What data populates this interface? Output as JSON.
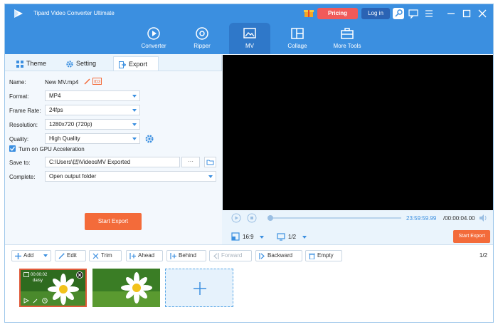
{
  "app": {
    "title": "Tipard Video Converter Ultimate",
    "pricing_label": "Pricing",
    "login_label": "Log in"
  },
  "nav": [
    {
      "label": "Converter",
      "icon": "converter-icon"
    },
    {
      "label": "Ripper",
      "icon": "ripper-icon"
    },
    {
      "label": "MV",
      "icon": "mv-icon",
      "active": true
    },
    {
      "label": "Collage",
      "icon": "collage-icon"
    },
    {
      "label": "More Tools",
      "icon": "toolbox-icon"
    }
  ],
  "tabs": [
    {
      "label": "Theme",
      "icon": "theme-icon"
    },
    {
      "label": "Setting",
      "icon": "gear-icon"
    },
    {
      "label": "Export",
      "icon": "export-icon",
      "active": true
    }
  ],
  "export": {
    "name_label": "Name:",
    "name_value": "New MV.mp4",
    "format_label": "Format:",
    "format_value": "MP4",
    "framerate_label": "Frame Rate:",
    "framerate_value": "24fps",
    "resolution_label": "Resolution:",
    "resolution_value": "1280x720 (720p)",
    "quality_label": "Quality:",
    "quality_value": "High Quality",
    "gpu_label": "Turn on GPU Acceleration",
    "gpu_checked": true,
    "saveto_label": "Save to:",
    "saveto_value": "C:\\Users\\凹\\VideosMV Exported",
    "browse_label": "···",
    "complete_label": "Complete:",
    "complete_value": "Open output folder",
    "start_export_label": "Start Export"
  },
  "player": {
    "time_current": "23:59:59.99",
    "time_total": "/00:00:04.00",
    "aspect": "16:9",
    "scale": "1/2",
    "export_label": "Start Export"
  },
  "toolbar": {
    "add": "Add",
    "edit": "Edit",
    "trim": "Trim",
    "ahead": "Ahead",
    "behind": "Behind",
    "forward": "Forward",
    "backward": "Backward",
    "empty": "Empty",
    "pages": "1/2"
  },
  "clips": [
    {
      "duration": "00:00:02",
      "name": "daisy",
      "selected": true
    },
    {
      "selected": false
    }
  ],
  "colors": {
    "brand_blue": "#3b8fe0",
    "accent_orange": "#f36b3a",
    "pricing_red": "#f05a5a"
  }
}
